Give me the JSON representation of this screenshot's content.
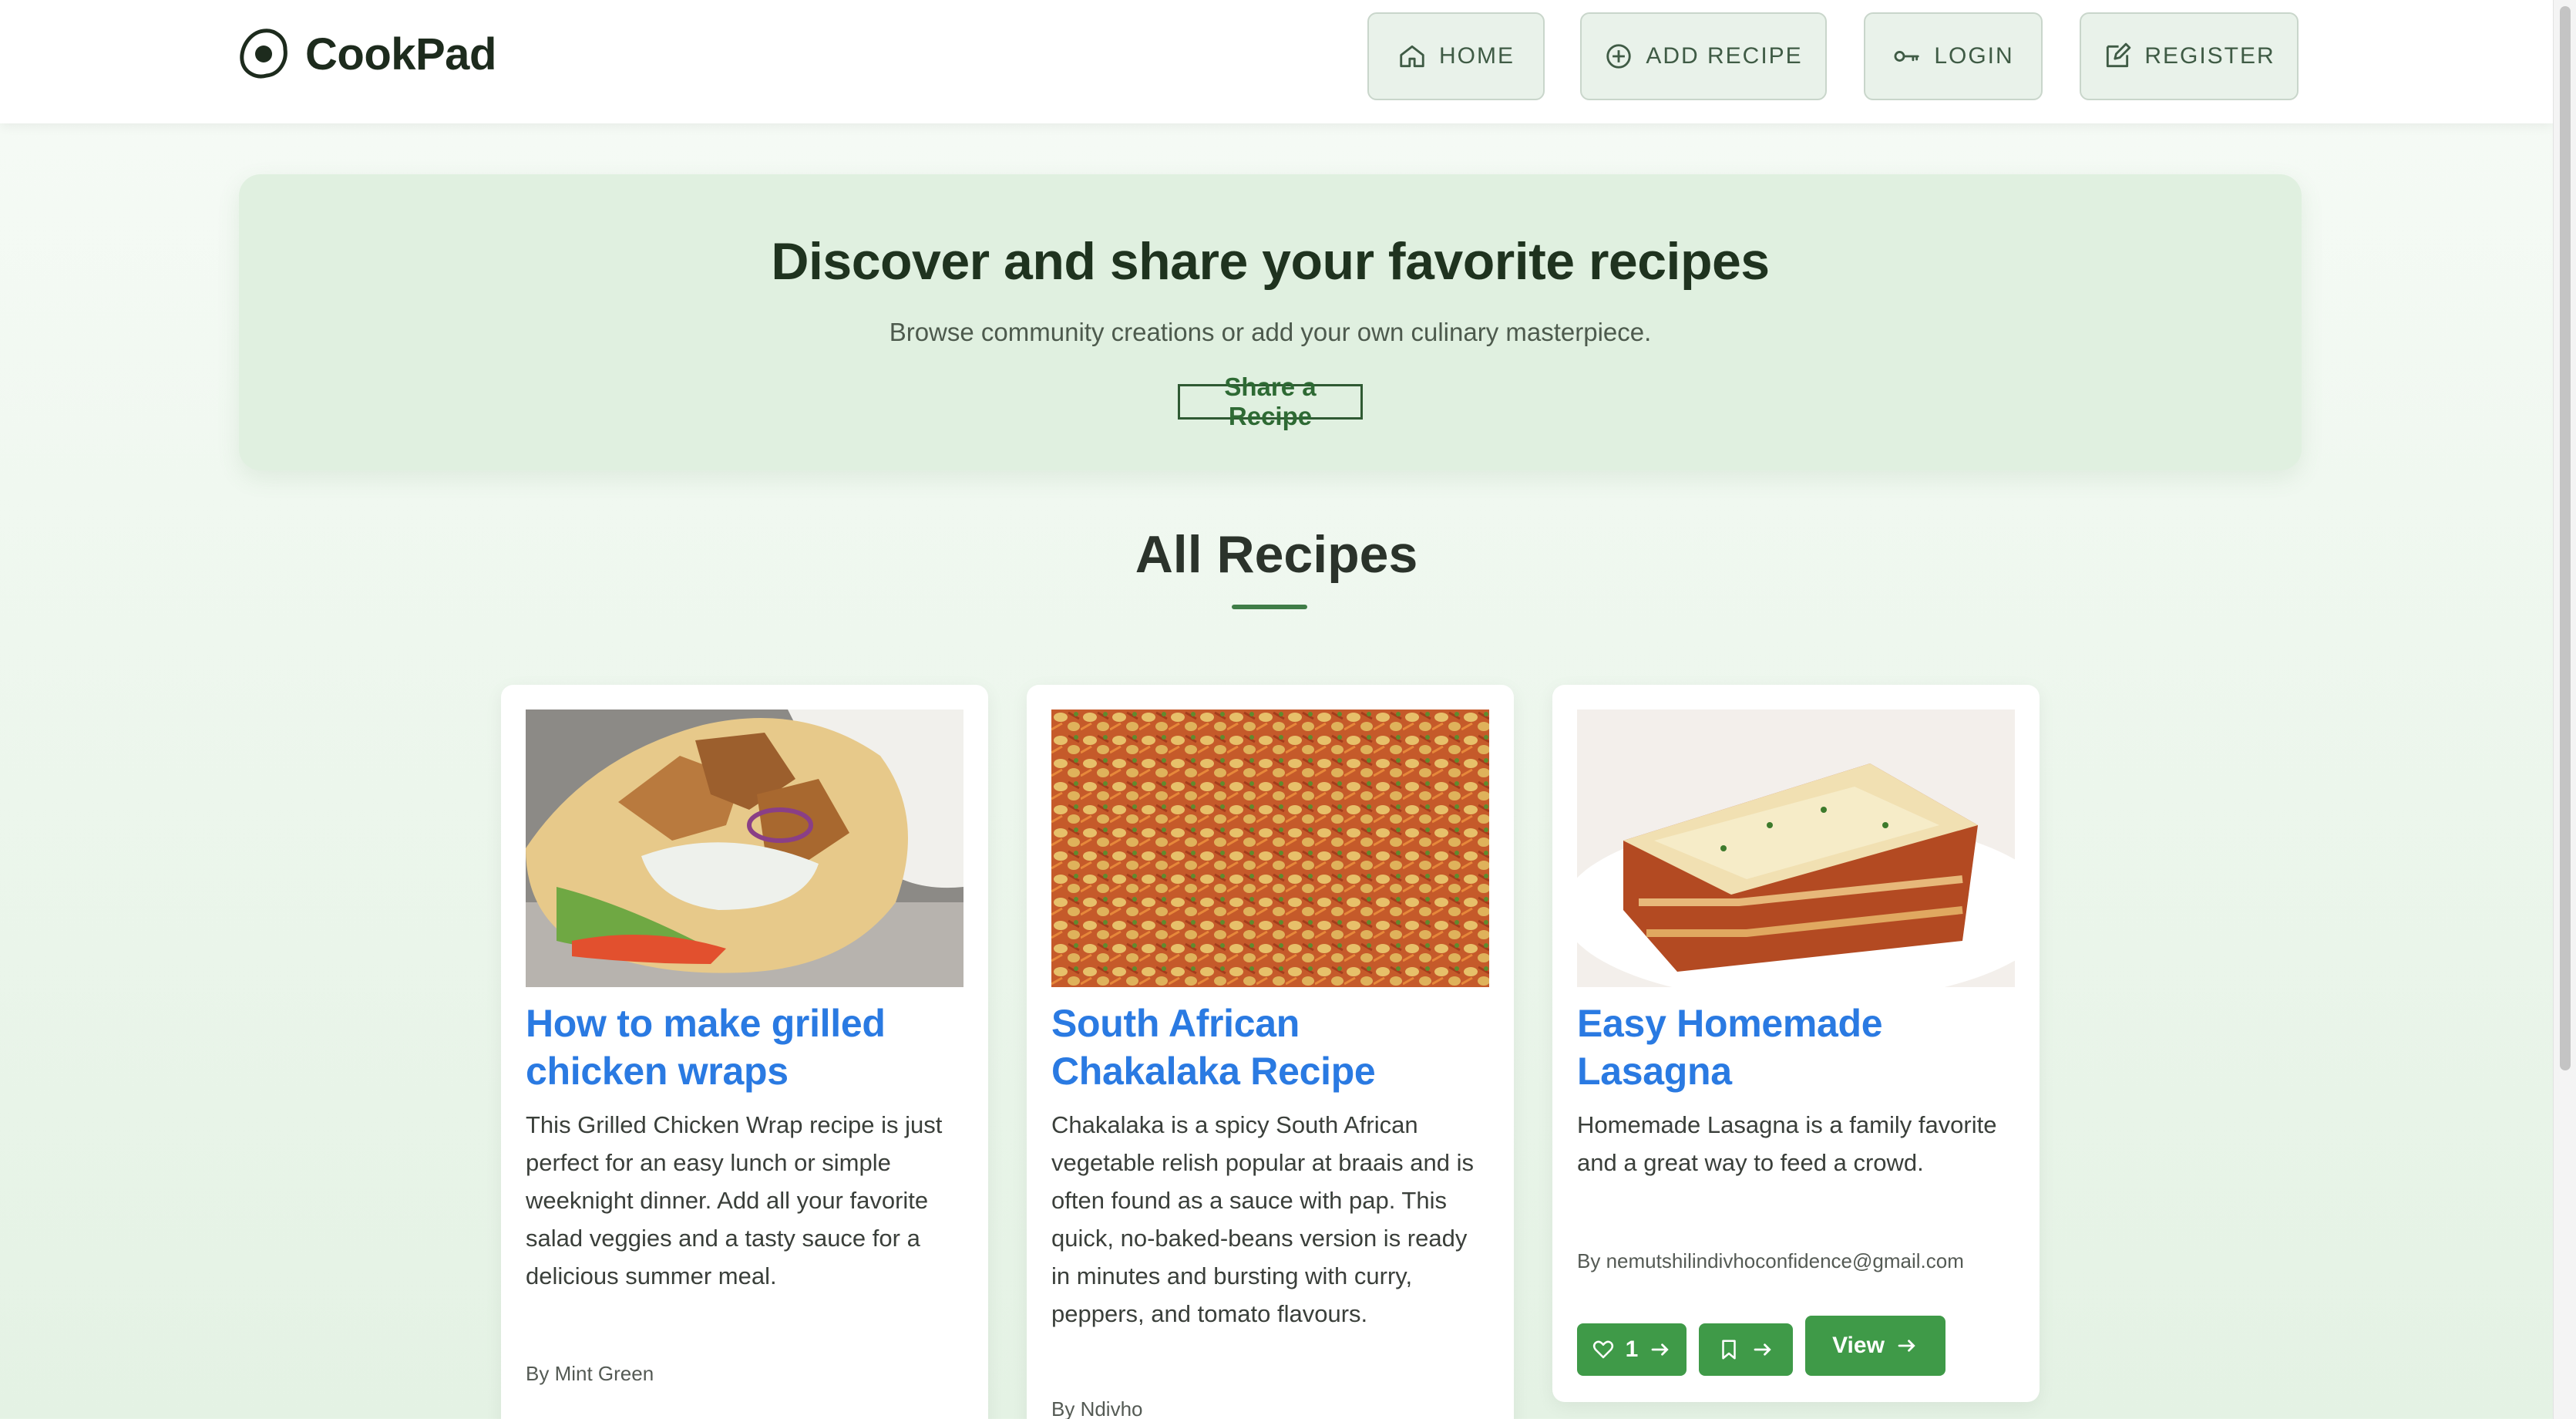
{
  "app": {
    "name": "CookPad"
  },
  "nav": {
    "home": "HOME",
    "add_recipe": "ADD RECIPE",
    "login": "LOGIN",
    "register": "REGISTER"
  },
  "hero": {
    "title": "Discover and share your favorite recipes",
    "subtitle": "Browse community creations or add your own culinary masterpiece.",
    "cta": "Share a Recipe"
  },
  "section": {
    "title": "All Recipes"
  },
  "recipes": [
    {
      "title": "How to make grilled chicken wraps",
      "description": "This Grilled Chicken Wrap recipe is just perfect for an easy lunch or simple weeknight dinner. Add all your favorite salad veggies and a tasty sauce for a delicious summer meal.",
      "author": "By Mint Green"
    },
    {
      "title": "South African Chakalaka Recipe",
      "description": "Chakalaka is a spicy South African vegetable relish popular at braais and is often found as a sauce with pap. This quick, no-baked-beans version is ready in minutes and bursting with curry, peppers, and tomato flavours.",
      "author": "By Ndivho"
    },
    {
      "title": "Easy Homemade Lasagna",
      "description": "Homemade Lasagna is a family favorite and a great way to feed a crowd.",
      "author": "By nemutshilindivhoconfidence@gmail.com",
      "likes": "1",
      "view_label": "View"
    }
  ],
  "icons": {
    "home": "home-icon",
    "add": "plus-circle-icon",
    "login": "key-icon",
    "register": "edit-icon",
    "like": "heart-icon",
    "bookmark": "bookmark-icon",
    "arrow": "arrow-right-icon"
  },
  "colors": {
    "accent_green": "#3f9a48",
    "title_blue": "#2a7ae2",
    "nav_bg": "#e9f2ea"
  }
}
